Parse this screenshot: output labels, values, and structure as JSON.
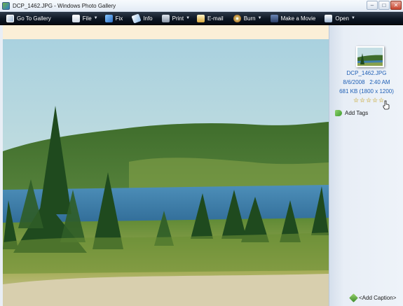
{
  "window": {
    "title": "DCP_1462.JPG - Windows Photo Gallery",
    "controls": {
      "minimize": "–",
      "maximize": "□",
      "close": "✕"
    }
  },
  "toolbar": {
    "items": [
      {
        "label": "Go To Gallery",
        "icon": "gallery-icon",
        "has_menu": false
      },
      {
        "label": "File",
        "icon": "file-icon",
        "has_menu": true
      },
      {
        "label": "Fix",
        "icon": "fix-icon",
        "has_menu": false
      },
      {
        "label": "Info",
        "icon": "info-icon",
        "has_menu": false
      },
      {
        "label": "Print",
        "icon": "print-icon",
        "has_menu": true
      },
      {
        "label": "E-mail",
        "icon": "email-icon",
        "has_menu": false
      },
      {
        "label": "Burn",
        "icon": "burn-icon",
        "has_menu": true
      },
      {
        "label": "Make a Movie",
        "icon": "movie-icon",
        "has_menu": false
      },
      {
        "label": "Open",
        "icon": "open-icon",
        "has_menu": true
      }
    ],
    "menu_arrow": "▼",
    "colors": {
      "background": "#0d1623",
      "text": "#ffffff"
    }
  },
  "photo": {
    "description_icon": "landscape-photo",
    "colors": {
      "sky": "#c7e0e5",
      "lake": "#3d7ea8",
      "forest": "#2e5a23",
      "meadow": "#a9b15a",
      "frame": "#fbefd7"
    }
  },
  "info_pane": {
    "filename": "DCP_1462.JPG",
    "date": "8/6/2008",
    "time": "2:40 AM",
    "size": "681 KB (1800 x 1200)",
    "rating": {
      "value": 0,
      "max": 5,
      "star_glyph": "☆"
    },
    "add_tags": "Add Tags",
    "add_caption": "<Add Caption>",
    "colors": {
      "link": "#1f5fb5",
      "panel": "#e8eef6"
    }
  }
}
